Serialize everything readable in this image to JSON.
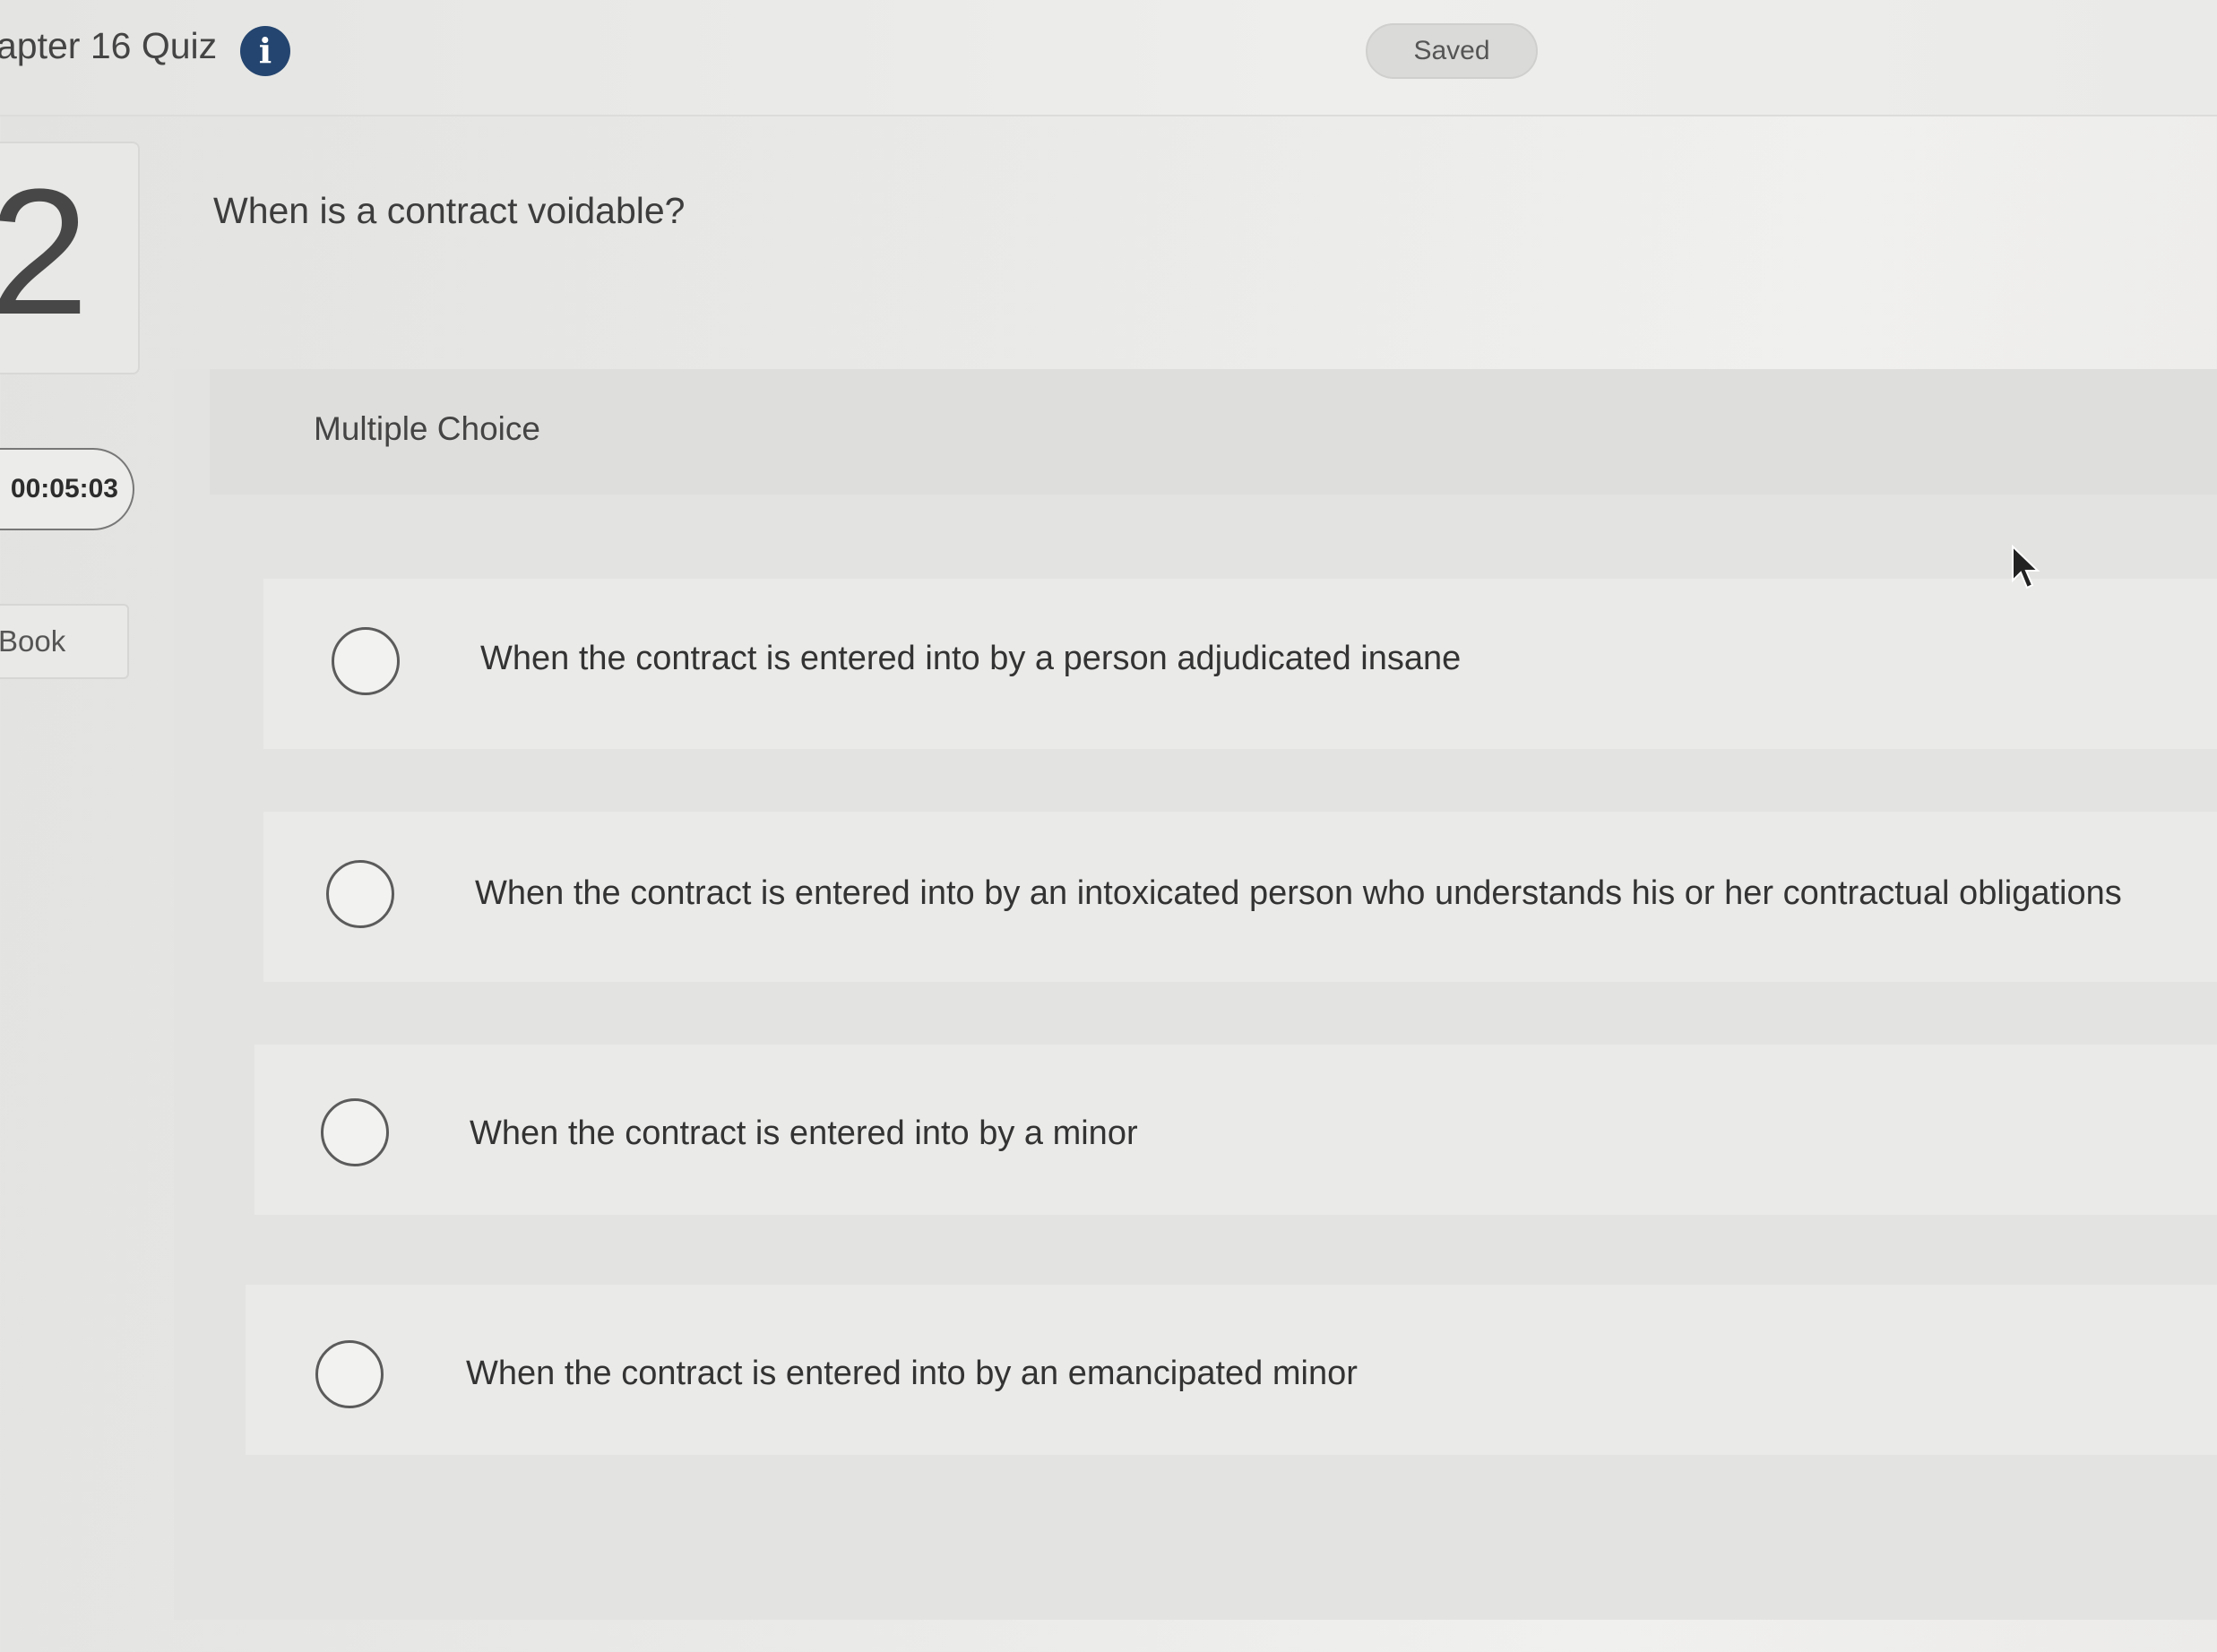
{
  "header": {
    "quiz_title": "apter 16 Quiz",
    "info_icon": "info-icon",
    "saved_label": "Saved"
  },
  "sidebar": {
    "question_number": "2",
    "timer": "00:05:03",
    "ebook_label": "Book"
  },
  "question": {
    "text": "When is a contract voidable?",
    "type_label": "Multiple Choice",
    "options": [
      {
        "label": "When the contract is entered into by a person adjudicated insane",
        "selected": false
      },
      {
        "label": "When the contract is entered into by an intoxicated person who understands his or her contractual obligations",
        "selected": false
      },
      {
        "label": "When the contract is entered into by a minor",
        "selected": false
      },
      {
        "label": "When the contract is entered into by an emancipated minor",
        "selected": false
      }
    ]
  },
  "colors": {
    "info_icon_bg": "#24456f",
    "background": "#e9e9e7"
  }
}
